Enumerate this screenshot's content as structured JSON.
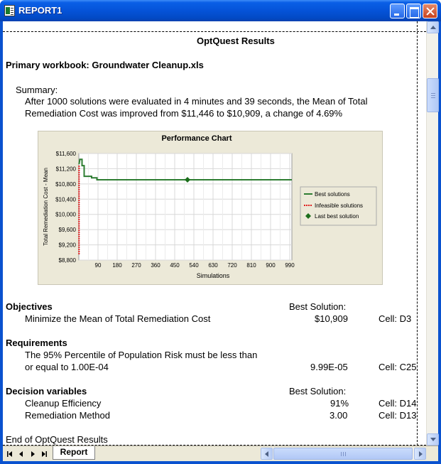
{
  "window": {
    "title": "REPORT1",
    "icon": "excel-sheet-icon"
  },
  "report": {
    "heading": "OptQuest Results",
    "workbook_line": "Primary workbook: Groundwater Cleanup.xls",
    "summary_label": "Summary:",
    "summary_line1": "After 1000 solutions were evaluated in 4 minutes and 39 seconds, the Mean of Total",
    "summary_line2": "Remediation Cost was improved from $11,446 to $10,909, a change of 4.69%",
    "objectives": {
      "title": "Objectives",
      "best_label": "Best Solution:",
      "items": [
        {
          "label": "Minimize the Mean of Total Remediation Cost",
          "value": "$10,909",
          "cell": "Cell: D3"
        }
      ]
    },
    "requirements": {
      "title": "Requirements",
      "items": [
        {
          "label_line1": "The 95% Percentile of Population Risk must be less than",
          "label_line2": "or equal to 1.00E-04",
          "value": "9.99E-05",
          "cell": "Cell: C25"
        }
      ]
    },
    "decision_variables": {
      "title": "Decision variables",
      "best_label": "Best Solution:",
      "items": [
        {
          "label": "Cleanup Efficiency",
          "value": "91%",
          "cell": "Cell: D14"
        },
        {
          "label": "Remediation Method",
          "value": "3.00",
          "cell": "Cell: D13"
        }
      ]
    },
    "end_text": "End of OptQuest Results"
  },
  "sheet_tabs": [
    {
      "label": "Report",
      "active": true
    }
  ],
  "chart_data": {
    "type": "line",
    "title": "Performance Chart",
    "xlabel": "Simulations",
    "ylabel": "Total Remediation Cost - Mean",
    "xlim": [
      0,
      1000
    ],
    "ylim": [
      8800,
      11600
    ],
    "x_ticks": [
      90,
      180,
      270,
      360,
      450,
      540,
      630,
      720,
      810,
      900,
      990
    ],
    "y_ticks": [
      8800,
      9200,
      9600,
      10000,
      10400,
      10800,
      11200,
      11600
    ],
    "x_tick_labels": [
      "90",
      "180",
      "270",
      "360",
      "450",
      "540",
      "630",
      "720",
      "810",
      "900",
      "990"
    ],
    "y_tick_labels": [
      "$8,800",
      "$9,200",
      "$9,600",
      "$10,000",
      "$10,400",
      "$10,800",
      "$11,200",
      "$11,600"
    ],
    "grid": true,
    "legend_position": "right",
    "series": [
      {
        "name": "Best solutions",
        "color": "#2e7d32",
        "style": "solid",
        "x": [
          1,
          5,
          5,
          15,
          15,
          25,
          25,
          60,
          60,
          85,
          85,
          1000
        ],
        "y": [
          11320,
          11446,
          11446,
          11446,
          11280,
          11280,
          11000,
          11000,
          10960,
          10960,
          10909,
          10909
        ]
      },
      {
        "name": "Infeasible solutions",
        "color": "#e02020",
        "style": "dotted",
        "x": [
          1,
          1
        ],
        "y": [
          8950,
          11300
        ]
      },
      {
        "name": "Last best solution",
        "color": "#1b6e1b",
        "style": "marker-diamond",
        "x": [
          510
        ],
        "y": [
          10909
        ]
      }
    ]
  }
}
